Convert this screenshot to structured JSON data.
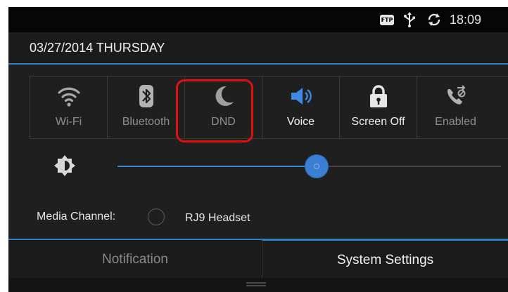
{
  "status_bar": {
    "ftp_badge": "FTP",
    "time": "18:09",
    "icons": [
      "ftp-icon",
      "usb-icon",
      "sync-icon"
    ]
  },
  "header": {
    "date": "03/27/2014 THURSDAY"
  },
  "quick_toggles": [
    {
      "label": "Wi-Fi",
      "icon": "wifi-icon",
      "active": false
    },
    {
      "label": "Bluetooth",
      "icon": "bluetooth-icon",
      "active": false
    },
    {
      "label": "DND",
      "icon": "moon-icon",
      "active": false,
      "highlighted": true
    },
    {
      "label": "Voice",
      "icon": "speaker-icon",
      "active": true
    },
    {
      "label": "Screen Off",
      "icon": "lock-icon",
      "active": true
    },
    {
      "label": "Enabled",
      "icon": "call-forward-icon",
      "active": false
    }
  ],
  "brightness": {
    "icon": "brightness-icon",
    "level": 0.52
  },
  "media_channel": {
    "label": "Media Channel:",
    "value": "RJ9 Headset"
  },
  "tabs": [
    {
      "label": "Notification",
      "selected": false
    },
    {
      "label": "System Settings",
      "selected": true
    }
  ],
  "colors": {
    "accent": "#2f7cc7",
    "highlight": "#e01010",
    "background": "#141414"
  }
}
